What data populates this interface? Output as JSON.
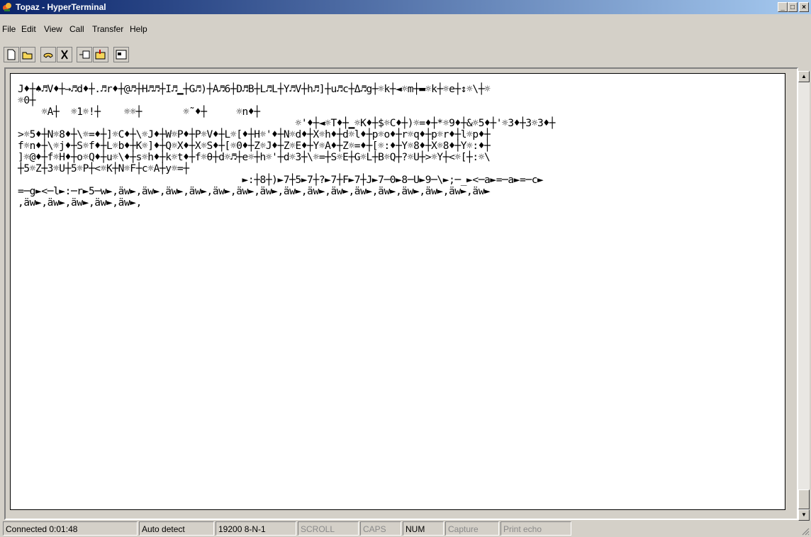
{
  "window": {
    "title": "Topaz - HyperTerminal",
    "minimize_label": "_",
    "maximize_label": "□",
    "close_label": "×"
  },
  "menu": [
    "File",
    "Edit",
    "View",
    "Call",
    "Transfer",
    "Help"
  ],
  "toolbar": {
    "buttons": [
      "new-icon",
      "open-icon",
      "dial-icon",
      "disconnect-icon",
      "send-icon",
      "receive-icon",
      "properties-icon"
    ]
  },
  "terminal": {
    "text": "J♦┼♠♬V♦┼→♬d♦┼.♬r♦┼@♬┼H♬♬┼I♬▁┼G♬)┼A♬6┼D♬B┼L♬L┼Y♬V┼h♬]┼u♬c┼Δ♬g┼☼k┼◄☼m┼▬☼k┼☼e┼↕☼\\┼☼\n☼0┼\n    ☼A┼  ☼1☼!┼    ☼☼┼       ☼˜♦┼     ☼n♦┼\n                                               ☼'♦┼◄☼T♦┼▁☼K♦┼$☼C♦┼)☼=♦┼*☼9♦┼&☼5♦┼'☼3♦┼3☼3♦┼\n>☼5♦┼N☼8♦┼\\☼=♦┼]☼C♦┼\\☼J♦┼W☼P♦┼P☼V♦┼L☼[♦┼H☼'♦┼N☼d♦┼X☼h♦┼d☼l♦┼p☼o♦┼r☼q♦┼p☼r♦┼l☼p♦┼\nf☼n♦┼\\☼j♦┼S☼f♦┼L☼b♦┼K☼]♦┼Q☼X♦┼X☼S♦┼[☼0♦┼Z☼J♦┼Z☼E♦┼Y☼A♦┼Z☼=♦┼[☼:♦┼Y☼8♦┼X☼8♦┼Y☼:♦┼\n]☼@♦┼f☼H♦┼o☼Q♦┼u☼\\♦┼s☼h♦┼k☼t♦┼f☼θ┼d☼♬┼e☼┼h☼'┼d☼3┼\\☼=┼S☼E┼G☼L┼B☼Q┼?☼U┼>☼Y┼<☼[┼:☼\\\n┼5☼Z┼3☼U┼5☼P┼<☼K┼N☼F┼c☼A┼y☼=┼\n                                      ►:┼8┼)►7┼5►7┼?►7┼F►7┼J►7─0►8─U►9─\\►;─_►<─a►=─a►=─c►\n=─g►<─l►:─r►5─w►,äw►,äw►,äw►,äw►,äw►,äw►,äw►,äw►,äw►,äw►,äw►,äw►,äw►,äw►,äw►,äw►\n,äw►,äw►,äw►,äw►,äw►,"
  },
  "statusbar": {
    "connected": "Connected 0:01:48",
    "detect": "Auto detect",
    "port": "19200 8-N-1",
    "scroll": "SCROLL",
    "caps": "CAPS",
    "num": "NUM",
    "capture": "Capture",
    "print_echo": "Print echo"
  },
  "colors": {
    "title_start": "#0a246a",
    "title_end": "#a6caf0",
    "chrome": "#d4d0c8"
  }
}
